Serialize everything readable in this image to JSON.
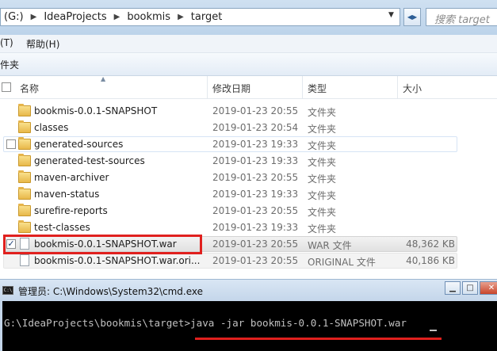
{
  "address": {
    "drive_partial": "(G:)",
    "segments": [
      "IdeaProjects",
      "bookmis",
      "target"
    ],
    "search_placeholder": "搜索 target"
  },
  "menu": {
    "tools_partial": "(T)",
    "help": "帮助(H)"
  },
  "toolbar": {
    "new_folder_partial": "件夹"
  },
  "columns": {
    "name": "名称",
    "modified": "修改日期",
    "type": "类型",
    "size": "大小"
  },
  "rows": [
    {
      "name": "bookmis-0.0.1-SNAPSHOT",
      "date": "2019-01-23 20:55",
      "type": "文件夹",
      "size": "",
      "kind": "folder"
    },
    {
      "name": "classes",
      "date": "2019-01-23 20:54",
      "type": "文件夹",
      "size": "",
      "kind": "folder"
    },
    {
      "name": "generated-sources",
      "date": "2019-01-23 19:33",
      "type": "文件夹",
      "size": "",
      "kind": "folder"
    },
    {
      "name": "generated-test-sources",
      "date": "2019-01-23 19:33",
      "type": "文件夹",
      "size": "",
      "kind": "folder"
    },
    {
      "name": "maven-archiver",
      "date": "2019-01-23 20:55",
      "type": "文件夹",
      "size": "",
      "kind": "folder"
    },
    {
      "name": "maven-status",
      "date": "2019-01-23 19:33",
      "type": "文件夹",
      "size": "",
      "kind": "folder"
    },
    {
      "name": "surefire-reports",
      "date": "2019-01-23 20:55",
      "type": "文件夹",
      "size": "",
      "kind": "folder"
    },
    {
      "name": "test-classes",
      "date": "2019-01-23 19:33",
      "type": "文件夹",
      "size": "",
      "kind": "folder"
    },
    {
      "name": "bookmis-0.0.1-SNAPSHOT.war",
      "date": "2019-01-23 20:55",
      "type": "WAR 文件",
      "size": "48,362 KB",
      "kind": "file"
    },
    {
      "name": "bookmis-0.0.1-SNAPSHOT.war.ori...",
      "date": "2019-01-23 20:55",
      "type": "ORIGINAL 文件",
      "size": "40,186 KB",
      "kind": "file"
    }
  ],
  "cmd": {
    "title": "管理员: C:\\Windows\\System32\\cmd.exe",
    "icon_text": "C:\\",
    "prompt": "G:\\IdeaProjects\\bookmis\\target>",
    "command": "java -jar bookmis-0.0.1-SNAPSHOT.war"
  },
  "colors": {
    "highlight_red": "#e0201e",
    "cmd_background": "#000000",
    "cmd_text": "#c0c0c0"
  }
}
